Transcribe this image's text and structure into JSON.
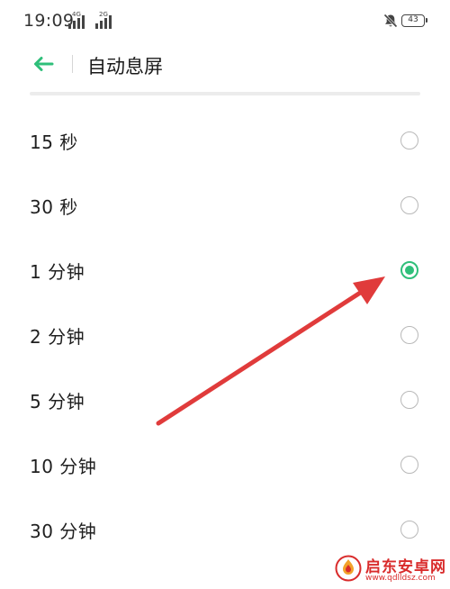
{
  "status_bar": {
    "time": "19:09",
    "network_1": "4G",
    "network_2": "2G",
    "battery_level": "43",
    "icons": [
      "signal-icon",
      "signal-icon",
      "mute-icon",
      "battery-icon"
    ]
  },
  "header": {
    "title": "自动息屏",
    "back_icon": "arrow-left-icon"
  },
  "options": [
    {
      "label": "15 秒",
      "selected": false
    },
    {
      "label": "30 秒",
      "selected": false
    },
    {
      "label": "1 分钟",
      "selected": true
    },
    {
      "label": "2 分钟",
      "selected": false
    },
    {
      "label": "5 分钟",
      "selected": false
    },
    {
      "label": "10 分钟",
      "selected": false
    },
    {
      "label": "30 分钟",
      "selected": false
    }
  ],
  "colors": {
    "accent": "#2fbf7a",
    "annotation": "#e03b3b",
    "watermark": "#d92c2c"
  },
  "watermark": {
    "name": "启东安卓网",
    "url": "www.qdlldsz.com"
  }
}
